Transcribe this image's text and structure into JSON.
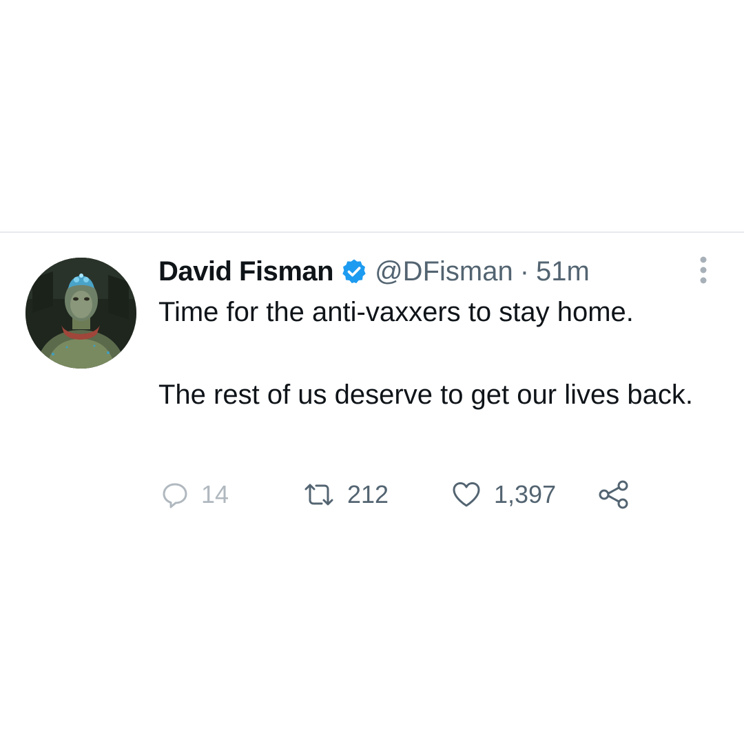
{
  "tweet": {
    "author_name": "David Fisman",
    "handle": "@DFisman",
    "separator": "·",
    "time": "51m",
    "verified": true,
    "text_paragraphs": [
      "Time for the anti-vaxxers to stay home.",
      "The rest of us deserve to get our lives back."
    ],
    "stats": {
      "replies": "14",
      "retweets": "212",
      "likes": "1,397"
    }
  },
  "icons": {
    "verified": "verified-badge-icon",
    "more": "more-vertical-icon",
    "reply": "reply-icon",
    "retweet": "retweet-icon",
    "like": "heart-icon",
    "share": "share-icon"
  },
  "colors": {
    "verified_blue": "#1d9bf0",
    "secondary_text": "#536471",
    "primary_text": "#0f1419",
    "divider": "#e6e9ec"
  }
}
